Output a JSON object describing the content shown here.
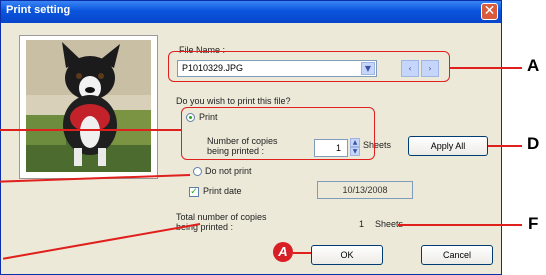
{
  "window": {
    "title": "Print setting",
    "close_glyph": "✕"
  },
  "file": {
    "label": "File Name :",
    "value": "P1010329.JPG",
    "prev_glyph": "‹",
    "next_glyph": "›"
  },
  "question": "Do you wish to print this file?",
  "print_option": {
    "label": "Print",
    "copies_label_1": "Number of copies",
    "copies_label_2": "being printed :",
    "copies_value": "1",
    "copies_unit": "Sheets"
  },
  "apply_all_label": "Apply All",
  "no_print_label": "Do not print",
  "print_date": {
    "label": "Print date",
    "value": "10/13/2008"
  },
  "total": {
    "label_1": "Total number of copies",
    "label_2": "being printed :",
    "value": "1",
    "unit": "Sheets"
  },
  "ok_label": "OK",
  "cancel_label": "Cancel",
  "callouts": {
    "a": "A",
    "d": "D",
    "f": "F",
    "badge": "A"
  },
  "colors": {
    "callout": "#e0201d",
    "title_bar": "#0a55dd",
    "dialog_bg": "#ece9d8",
    "badge": "#d81f26"
  },
  "icons": {
    "combo": "chevron-down-icon",
    "prev": "chevron-left-icon",
    "next": "chevron-right-icon",
    "close": "close-icon"
  }
}
